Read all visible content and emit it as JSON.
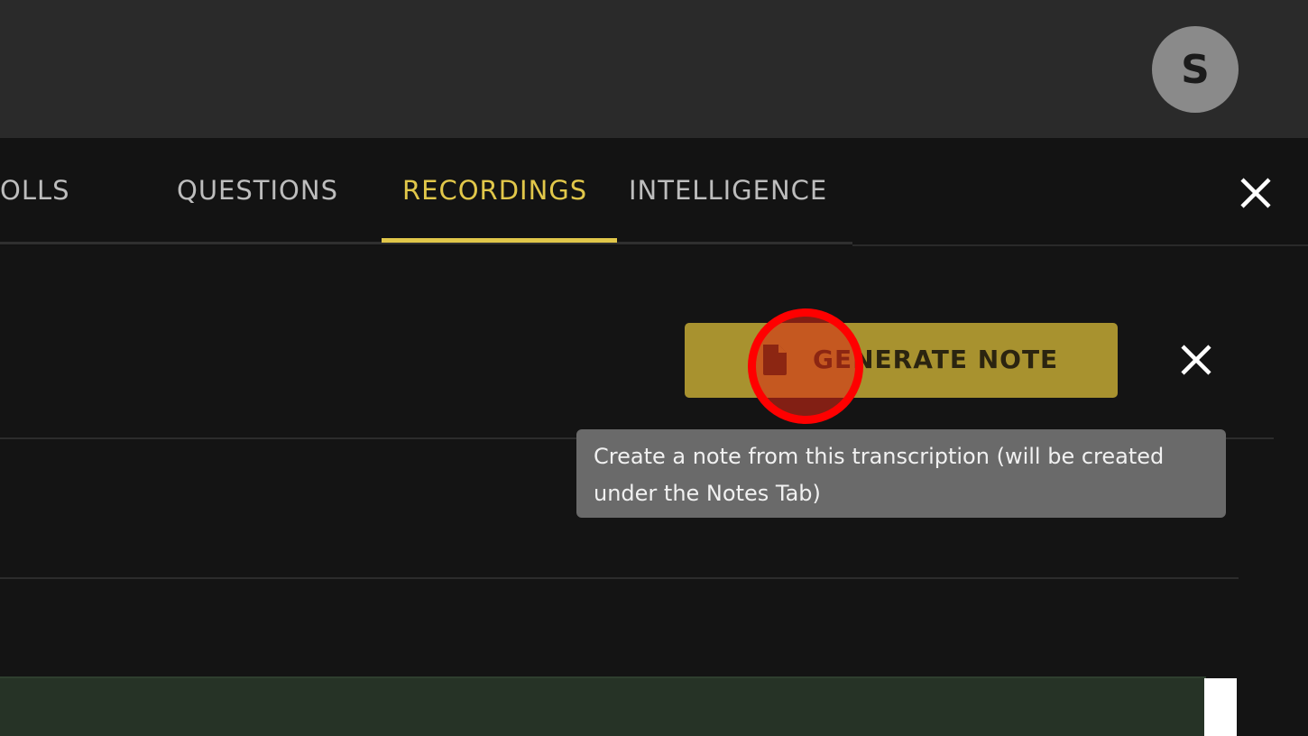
{
  "header": {
    "avatar_initial": "S"
  },
  "tabs": [
    {
      "label": "OLLS",
      "active": false
    },
    {
      "label": "QUESTIONS",
      "active": false
    },
    {
      "label": "RECORDINGS",
      "active": true
    },
    {
      "label": "INTELLIGENCE",
      "active": false
    }
  ],
  "toolbar": {
    "generate_note_label": "GENERATE NOTE"
  },
  "tooltip": {
    "line1": "Create a note from this transcription (will be created",
    "line2": "under the Notes Tab)"
  },
  "icons": {
    "close": "close-icon",
    "document": "document-icon"
  },
  "colors": {
    "accent": "#e1c74a",
    "button": "#a8922f",
    "highlight": "#ff0000",
    "background": "#141414",
    "header": "#2a2a2a"
  }
}
